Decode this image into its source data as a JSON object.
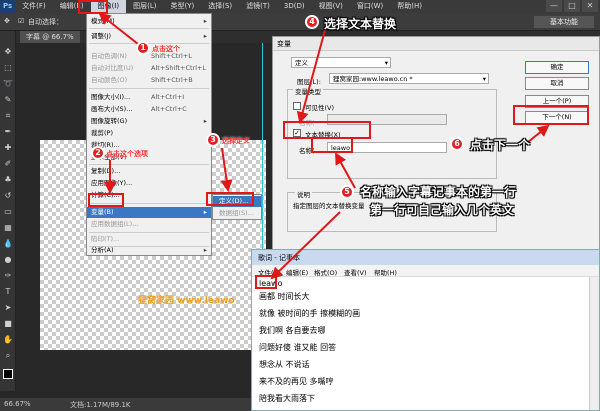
{
  "menubar": {
    "items": [
      "文件(F)",
      "编辑(E)",
      "图像(I)",
      "图层(L)",
      "类型(Y)",
      "选择(S)",
      "滤镜(T)",
      "3D(D)",
      "视图(V)",
      "窗口(W)",
      "帮助(H)"
    ],
    "active_index": 2,
    "window_controls": [
      "—",
      "□",
      "✕"
    ]
  },
  "options_bar": {
    "auto_select_label": "自动选择：",
    "essentials_label": "基本功能"
  },
  "document": {
    "tab": "字幕 @ 66.7%",
    "watermark": "狸窝家园 www.leawo",
    "zoom": "66.67%",
    "doc_info": "文档:1.17M/89.1K"
  },
  "image_menu": {
    "items": [
      {
        "label": "模式(M)",
        "shortcut": "",
        "submenu": true,
        "disabled": false
      },
      {
        "label": "调整(J)",
        "shortcut": "",
        "submenu": true,
        "disabled": false
      },
      {
        "label": "自动色调(N)",
        "shortcut": "Shift+Ctrl+L",
        "submenu": false,
        "disabled": true
      },
      {
        "label": "自动对比度(U)",
        "shortcut": "Alt+Shift+Ctrl+L",
        "submenu": false,
        "disabled": true
      },
      {
        "label": "自动颜色(O)",
        "shortcut": "Shift+Ctrl+B",
        "submenu": false,
        "disabled": true
      },
      {
        "label": "图像大小(I)...",
        "shortcut": "Alt+Ctrl+I",
        "submenu": false,
        "disabled": false
      },
      {
        "label": "画布大小(S)...",
        "shortcut": "Alt+Ctrl+C",
        "submenu": false,
        "disabled": false
      },
      {
        "label": "图像旋转(G)",
        "shortcut": "",
        "submenu": true,
        "disabled": false
      },
      {
        "label": "裁剪(P)",
        "shortcut": "",
        "submenu": false,
        "disabled": false
      },
      {
        "label": "裁切(R)...",
        "shortcut": "",
        "submenu": false,
        "disabled": false
      },
      {
        "label": "显示全部(V)",
        "shortcut": "",
        "submenu": false,
        "disabled": false
      },
      {
        "label": "复制(D)...",
        "shortcut": "",
        "submenu": false,
        "disabled": false
      },
      {
        "label": "应用图像(Y)...",
        "shortcut": "",
        "submenu": false,
        "disabled": false
      },
      {
        "label": "计算(C)...",
        "shortcut": "",
        "submenu": false,
        "disabled": false
      },
      {
        "label": "变量(B)",
        "shortcut": "",
        "submenu": true,
        "disabled": false
      },
      {
        "label": "应用数据组(L)...",
        "shortcut": "",
        "submenu": false,
        "disabled": true
      },
      {
        "label": "陷印(T)...",
        "shortcut": "",
        "submenu": false,
        "disabled": true
      },
      {
        "label": "分析(A)",
        "shortcut": "",
        "submenu": true,
        "disabled": false
      }
    ],
    "submenu": [
      "定义(D)...",
      "数据组(S)..."
    ]
  },
  "dialog": {
    "title": "变量",
    "mode_select": "定义",
    "layer_label": "图层(L):",
    "layer_value": "狸窝家园:www.leawo.cn *",
    "var_type_label": "变量类型",
    "visibility_label": "可见性(V)",
    "name_label_1": "名称(",
    "text_replace_label": "文本替换(X)",
    "name_label_2": "名称(",
    "name_value": "leawo",
    "desc_label": "说明",
    "desc_text": "指定图层的文本替换变量",
    "btn_ok": "确定",
    "btn_cancel": "取消",
    "btn_prev": "上一个(P)",
    "btn_next": "下一个(N)"
  },
  "notepad": {
    "title": "歌词 - 记事本",
    "menus": [
      "文件(F)",
      "编辑(E)",
      "格式(O)",
      "查看(V)",
      "帮助(H)"
    ],
    "lines": [
      "leawo",
      "画都  时间长大",
      "就像  被时间的手  擦模糊的画",
      "我们啊  各自要去哪",
      "问题好傻  谁又能  回答",
      "想念从  不说话",
      "来不及的再见  多嘴哼",
      "陪我看大雨落下"
    ]
  },
  "annotations": {
    "step1": {
      "num": "1",
      "text": "点击这个"
    },
    "step2": {
      "num": "2",
      "text": "点击这个选项"
    },
    "step3": {
      "num": "3",
      "text": "选择定义"
    },
    "step4": {
      "num": "4",
      "text": "选择文本替换"
    },
    "step5": {
      "num": "5",
      "text": "名称输入字幕记事本的第一行",
      "text2": "第一行可自己输入几个英文"
    },
    "step6": {
      "num": "6",
      "text": "点击下一个"
    }
  },
  "colors": {
    "annotation_red": "#e01818",
    "menu_highlight": "#3b78c4",
    "guide_cyan": "#2ec4d6",
    "watermark_orange": "#f0a020"
  }
}
